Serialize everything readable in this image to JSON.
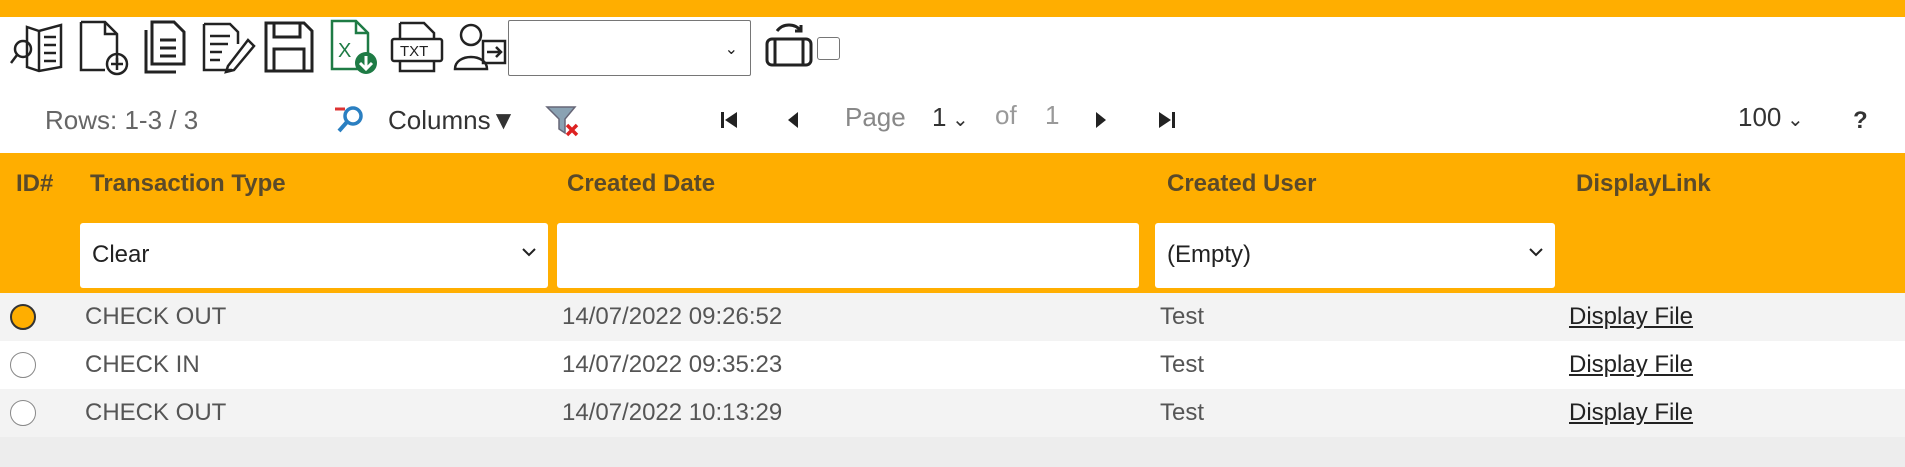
{
  "toolbar": {
    "icons": [
      "view-record-icon",
      "new-record-icon",
      "copy-record-icon",
      "edit-record-icon",
      "save-icon",
      "excel-export-icon",
      "txt-export-icon",
      "user-transfer-icon"
    ],
    "dropdown_value": "",
    "txt_label": "TXT",
    "excel_label": "X"
  },
  "pager": {
    "rows_info": "Rows: 1-3 / 3",
    "columns_label": "Columns▼",
    "page_label": "Page",
    "page_value": "1",
    "of_label": "of",
    "total_pages": "1",
    "per_page": "100",
    "help": "?"
  },
  "grid": {
    "columns": [
      "ID#",
      "Transaction Type",
      "Created Date",
      "Created User",
      "DisplayLink"
    ],
    "filters": {
      "transaction_type": "Clear",
      "created_date": "",
      "created_user": "(Empty)"
    },
    "rows": [
      {
        "selected": true,
        "type": "CHECK OUT",
        "date": "14/07/2022 09:26:52",
        "user": "Test",
        "link": "Display File"
      },
      {
        "selected": false,
        "type": "CHECK IN",
        "date": "14/07/2022 09:35:23",
        "user": "Test",
        "link": "Display File"
      },
      {
        "selected": false,
        "type": "CHECK OUT",
        "date": "14/07/2022 10:13:29",
        "user": "Test",
        "link": "Display File"
      }
    ]
  },
  "colors": {
    "accent": "#FFAE00",
    "excel_green": "#1E7B45"
  }
}
